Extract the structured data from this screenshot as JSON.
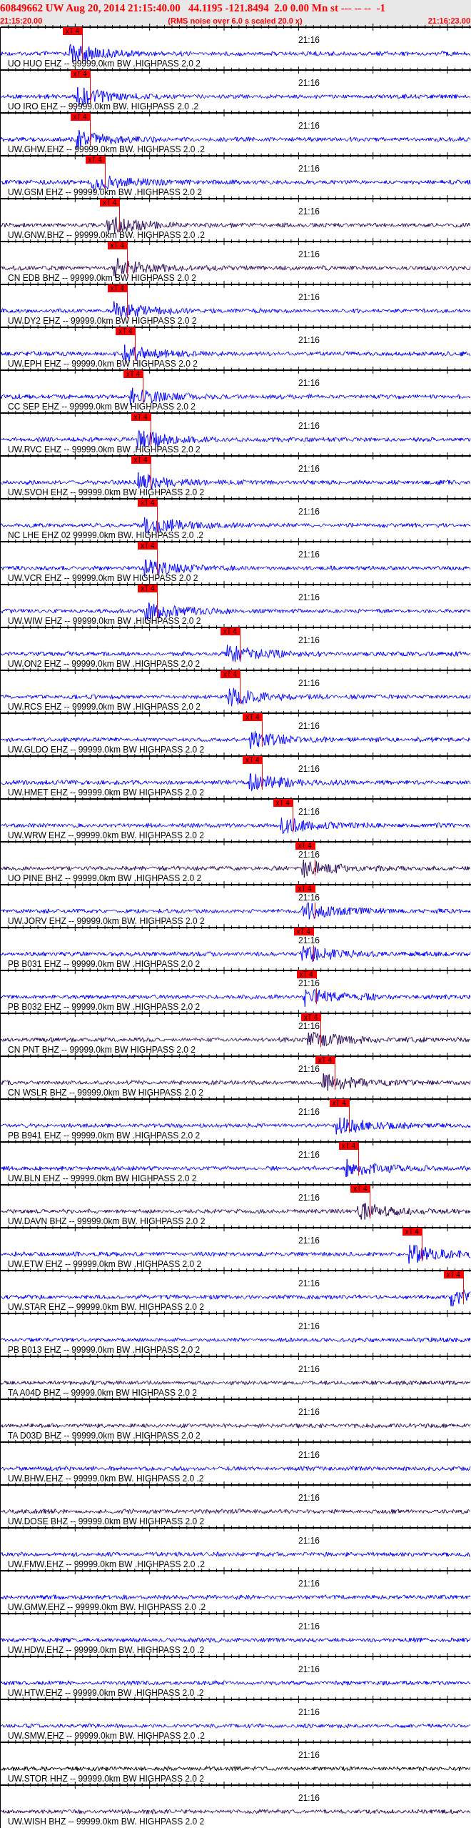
{
  "header": {
    "title": "60849662 UW Aug 20, 2014 21:15:40.00   44.1195 -121.8494  2.0 0.00 Mn st --- -- --  -1",
    "start_time": "21:15:20.00",
    "note": "(RMS noise over 6.0 s scaled 20.0 x)",
    "end_time": "21:16:23.00"
  },
  "channels": [
    {
      "label": "UO HUO EHZ -- 99999.0km BW .HIGHPASS 2.0 2",
      "time_label": "21:16",
      "color": "#0000ff",
      "pick": {
        "label": "xT 4",
        "level": 0.173
      }
    },
    {
      "label": "UO IRO EHZ -- 99999.0km BW. HIGHPASS 2.0 .2",
      "time_label": "21:16",
      "color": "#0000ff",
      "pick": {
        "label": "xT 4",
        "level": 0.189
      }
    },
    {
      "label": "UW.GHW.EHZ -- 99999.0km BW. HIGHPASS 2.0 .2",
      "time_label": "21:16",
      "color": "#0000ff",
      "pick": {
        "label": "xT 4",
        "level": 0.189
      }
    },
    {
      "label": "UW.GSM EHZ -- 99999.0km BW .HIGHPASS 2.0 2",
      "time_label": "21:16",
      "color": "#0000ff",
      "pick": {
        "label": "xT 4",
        "level": 0.221
      }
    },
    {
      "label": "UW.GNW.BHZ -- 99999.0km BW. HIGHPASS 2.0 .2",
      "time_label": "21:16",
      "color": "#2b0a5a",
      "pick": {
        "label": "xT 4",
        "level": 0.252
      }
    },
    {
      "label": "CN EDB BHZ -- 99999.0km BW HIGHPASS 2.0 2",
      "time_label": "21:16",
      "color": "#2b0a5a",
      "pick": {
        "label": "xT 4",
        "level": 0.268
      }
    },
    {
      "label": "UW.DY2 EHZ -- 99999.0km BW HIGHPASS 2.0 2",
      "time_label": "21:16",
      "color": "#0000ff",
      "pick": {
        "label": "xT 4",
        "level": 0.268
      }
    },
    {
      "label": "UW.EPH EHZ -- 99999.0km BW HIGHPASS 2.0 2",
      "time_label": "21:16",
      "color": "#0000ff",
      "pick": {
        "label": "xT 4",
        "level": 0.286
      }
    },
    {
      "label": "CC SEP EHZ -- 99999.0km BW HIGHPASS 2.0 2",
      "time_label": "21:16",
      "color": "#0000ff",
      "pick": {
        "label": "xT 4",
        "level": 0.302
      }
    },
    {
      "label": "UW.RVC EHZ -- 99999.0km BW .HIGHPASS 2.0 2",
      "time_label": "21:16",
      "color": "#0000ff",
      "pick": {
        "label": "xT 4",
        "level": 0.318
      }
    },
    {
      "label": "UW.SVOH EHZ -- 99999.0km BW HIGHPASS 2.0 2",
      "time_label": "21:16",
      "color": "#0000ff",
      "pick": {
        "label": "xT 4",
        "level": 0.318
      }
    },
    {
      "label": "NC LHE EHZ 02 99999.0km BW. HIGHPASS 2.0 .2",
      "time_label": "21:16",
      "color": "#0000ff",
      "pick": {
        "label": "xT 4",
        "level": 0.333
      }
    },
    {
      "label": "UW.VCR EHZ -- 99999.0km BW HIGHPASS 2.0 2",
      "time_label": "21:16",
      "color": "#0000ff",
      "pick": {
        "label": "xT 4",
        "level": 0.333
      }
    },
    {
      "label": "UW.WIW EHZ -- 99999.0km BW .HIGHPASS 2.0 2",
      "time_label": "21:16",
      "color": "#0000ff",
      "pick": {
        "label": "xT 4",
        "level": 0.333
      }
    },
    {
      "label": "UW.ON2 EHZ -- 99999.0km BW .HIGHPASS 2.0 2",
      "time_label": "21:16",
      "color": "#0000ff",
      "pick": {
        "label": "xT 4",
        "level": 0.508
      }
    },
    {
      "label": "UW.RCS EHZ -- 99999.0km BW .HIGHPASS 2.0 2",
      "time_label": "21:16",
      "color": "#0000ff",
      "pick": {
        "label": "xT 4",
        "level": 0.508
      }
    },
    {
      "label": "UW.GLDO EHZ -- 99999.0km BW HIGHPASS 2.0 2",
      "time_label": "21:16",
      "color": "#0000ff",
      "pick": {
        "label": "xT 4",
        "level": 0.556
      }
    },
    {
      "label": "UW.HMET EHZ -- 99999.0km BW HIGHPASS 2.0 2",
      "time_label": "21:16",
      "color": "#0000ff",
      "pick": {
        "label": "xT 4",
        "level": 0.556
      }
    },
    {
      "label": "UW.WRW EHZ -- 99999.0km BW. HIGHPASS 2.0 2",
      "time_label": "21:16",
      "color": "#0000ff",
      "pick": {
        "label": "xT 4",
        "level": 0.62
      }
    },
    {
      "label": "UO PINE BHZ -- 99999.0km BW .HIGHPASS 2.0 2",
      "time_label": "21:16",
      "color": "#2b0a5a",
      "pick": {
        "label": "xT 4",
        "level": 0.667
      }
    },
    {
      "label": "UW.JORV EHZ -- 99999.0km BW. HIGHPASS 2.0 2",
      "time_label": "21:16",
      "color": "#0000ff",
      "pick": {
        "label": "xT 4",
        "level": 0.667
      }
    },
    {
      "label": "PB B031 EHZ -- 99999.0km BW .HIGHPASS 2.0 2",
      "time_label": "21:16",
      "color": "#0000ff",
      "pick": {
        "label": "xT 4",
        "level": 0.664
      }
    },
    {
      "label": "PB B032 EHZ -- 99999.0km BW .HIGHPASS 2.0 2",
      "time_label": "21:16",
      "color": "#0000ff",
      "pick": {
        "label": "xT 4",
        "level": 0.67
      }
    },
    {
      "label": "CN PNT BHZ -- 99999.0km BW HIGHPASS 2.0 2",
      "time_label": "21:16",
      "color": "#2b0a5a",
      "pick": {
        "label": "xT 4",
        "level": 0.68
      }
    },
    {
      "label": "CN WSLR BHZ -- 99999.0km BW HIGHPASS 2.0 2",
      "time_label": "21:16",
      "color": "#2b0a5a",
      "pick": {
        "label": "xT 4",
        "level": 0.71
      }
    },
    {
      "label": "PB B941 EHZ -- 99999.0km BW .HIGHPASS 2.0 2",
      "time_label": "21:16",
      "color": "#0000ff",
      "pick": {
        "label": "xT 4",
        "level": 0.74
      }
    },
    {
      "label": "UW.BLN EHZ -- 99999.0km BW HIGHPASS 2.0 2",
      "time_label": "21:16",
      "color": "#0000ff",
      "pick": {
        "label": "xT 4",
        "level": 0.76
      }
    },
    {
      "label": "UW.DAVN BHZ -- 99999.0km BW. HIGHPASS 2.0 2",
      "time_label": "21:16",
      "color": "#2b0a5a",
      "pick": {
        "label": "xT 4",
        "level": 0.785
      }
    },
    {
      "label": "UW.ETW EHZ -- 99999.0km BW .HIGHPASS 2.0 2",
      "time_label": "21:16",
      "color": "#0000ff",
      "pick": {
        "label": "xT 4",
        "level": 0.895
      }
    },
    {
      "label": "UW.STAR EHZ -- 99999.0km BW. HIGHPASS 2.0 2",
      "time_label": "21:16",
      "color": "#0000ff",
      "pick": {
        "label": "xT 4",
        "level": 0.983
      }
    },
    {
      "label": "PB B013 EHZ -- 99999.0km BW .HIGHPASS 2.0 2",
      "time_label": "21:16",
      "color": "#0000ff"
    },
    {
      "label": "TA A04D BHZ -- 99999.0km BW HIGHPASS 2.0 2",
      "time_label": "21:16",
      "color": "#2b0a5a"
    },
    {
      "label": "TA D03D BHZ -- 99999.0km BW .HIGHPASS 2.0 2",
      "time_label": "21:16",
      "color": "#2b0a5a"
    },
    {
      "label": "UW.BHW.EHZ -- 99999.0km BW. HIGHPASS 2.0 .2",
      "time_label": "21:16",
      "color": "#0000ff"
    },
    {
      "label": "UW.DOSE BHZ -- 99999.0km BW HIGHPASS 2.0 2",
      "time_label": "21:16",
      "color": "#2b0a5a"
    },
    {
      "label": "UW.FMW.EHZ -- 99999.0km BW .HIGHPASS 2.0 .2",
      "time_label": "21:16",
      "color": "#0000ff"
    },
    {
      "label": "UW.GMW.EHZ -- 99999.0km BW. HIGHPASS 2.0 .2",
      "time_label": "21:16",
      "color": "#0000ff"
    },
    {
      "label": "UW.HDW.EHZ -- 99999.0km BW. HIGHPASS 2.0 .2",
      "time_label": "21:16",
      "color": "#0000ff"
    },
    {
      "label": "UW.HTW.EHZ -- 99999.0km BW .HIGHPASS 2.0 .2",
      "time_label": "21:16",
      "color": "#0000ff"
    },
    {
      "label": "UW.SMW.EHZ -- 99999.0km BW. HIGHPASS 2.0 .2",
      "time_label": "21:16",
      "color": "#0000ff"
    },
    {
      "label": "UW.STOR HHZ -- 99999.0km BW HIGHPASS 2.0 2",
      "time_label": "21:16",
      "color": "#000000"
    },
    {
      "label": "UW.WISH BHZ -- 99999.0km BW. HIGHPASS 2.0 2",
      "time_label": "21:16",
      "color": "#2b0a5a"
    }
  ]
}
